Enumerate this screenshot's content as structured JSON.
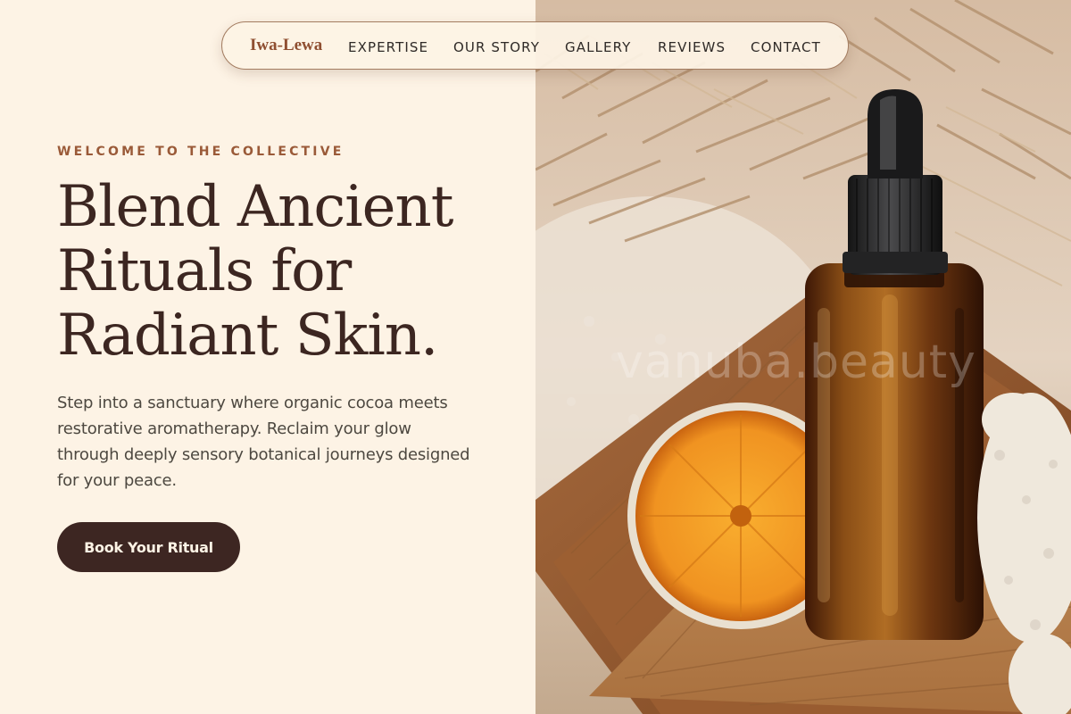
{
  "header": {
    "brand": "Iwa-Lewa",
    "nav_items": [
      "EXPERTISE",
      "OUR STORY",
      "GALLERY",
      "REVIEWS",
      "CONTACT"
    ]
  },
  "hero": {
    "eyebrow": "WELCOME TO THE COLLECTIVE",
    "headline_lines": [
      "Blend Ancient",
      "Rituals for",
      "Radiant Skin."
    ],
    "description": "Step into a sanctuary where organic cocoa meets restorative aromatherapy. Reclaim your glow through deeply sensory botanical journeys designed for your peace.",
    "cta_label": "Book Your Ritual"
  },
  "image": {
    "watermark": "vanuba.beauty",
    "icon": "amber-dropper-bottle-photo"
  },
  "colors": {
    "background": "#fdf3e5",
    "heading": "#3c2621",
    "accent": "#9a5a38",
    "button": "#3d2622"
  }
}
